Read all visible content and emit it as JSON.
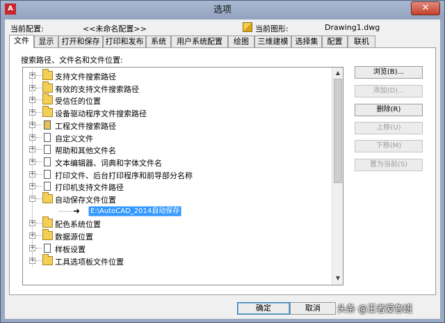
{
  "window": {
    "title": "选项",
    "close_glyph": "✕"
  },
  "profile": {
    "current_profile_label": "当前配置:",
    "current_profile_value": "<<未命名配置>>",
    "current_drawing_label": "当前图形:",
    "current_drawing_value": "Drawing1.dwg"
  },
  "tabs": [
    "文件",
    "显示",
    "打开和保存",
    "打印和发布",
    "系统",
    "用户系统配置",
    "绘图",
    "三维建模",
    "选择集",
    "配置",
    "联机"
  ],
  "panel": {
    "label": "搜索路径、文件名和文件位置:"
  },
  "tree": {
    "items": [
      {
        "label": "支持文件搜索路径",
        "icon": "folder-icon",
        "expander": "+"
      },
      {
        "label": "有效的支持文件搜索路径",
        "icon": "folder-icon",
        "expander": "+"
      },
      {
        "label": "受信任的位置",
        "icon": "folder-icon",
        "expander": "+"
      },
      {
        "label": "设备驱动程序文件搜索路径",
        "icon": "folder-icon",
        "expander": "+"
      },
      {
        "label": "工程文件搜索路径",
        "icon": "project-icon",
        "expander": "+"
      },
      {
        "label": "自定义文件",
        "icon": "file-icon",
        "expander": "+"
      },
      {
        "label": "帮助和其他文件名",
        "icon": "file-icon",
        "expander": "+"
      },
      {
        "label": "文本编辑器、词典和字体文件名",
        "icon": "file-icon",
        "expander": "+"
      },
      {
        "label": "打印文件、后台打印程序和前导部分名称",
        "icon": "file-icon",
        "expander": "+"
      },
      {
        "label": "打印机支持文件路径",
        "icon": "file-icon",
        "expander": "+"
      },
      {
        "label": "自动保存文件位置",
        "icon": "folder-icon",
        "expander": "−"
      },
      {
        "label": "配色系统位置",
        "icon": "folder-icon",
        "expander": "+"
      },
      {
        "label": "数据源位置",
        "icon": "folder-icon",
        "expander": "+"
      },
      {
        "label": "样板设置",
        "icon": "file-icon",
        "expander": "+"
      },
      {
        "label": "工具选项板文件位置",
        "icon": "folder-icon",
        "expander": "+"
      }
    ],
    "selected_child": {
      "arrow": "➜",
      "path": "E:\\AutoCAD_2014自动保存"
    }
  },
  "side_buttons": [
    {
      "label": "浏览(B)...",
      "enabled": true
    },
    {
      "label": "添加(D)...",
      "enabled": false
    },
    {
      "label": "删除(R)",
      "enabled": true
    },
    {
      "label": "上移(U)",
      "enabled": false
    },
    {
      "label": "下移(M)",
      "enabled": false
    },
    {
      "label": "置为当前(S)",
      "enabled": false
    }
  ],
  "bottom_buttons": {
    "ok": "确定",
    "cancel": "取消"
  },
  "watermark": "头条 @王者爱鲁班",
  "scroll": {
    "up": "▲",
    "down": "▼"
  }
}
